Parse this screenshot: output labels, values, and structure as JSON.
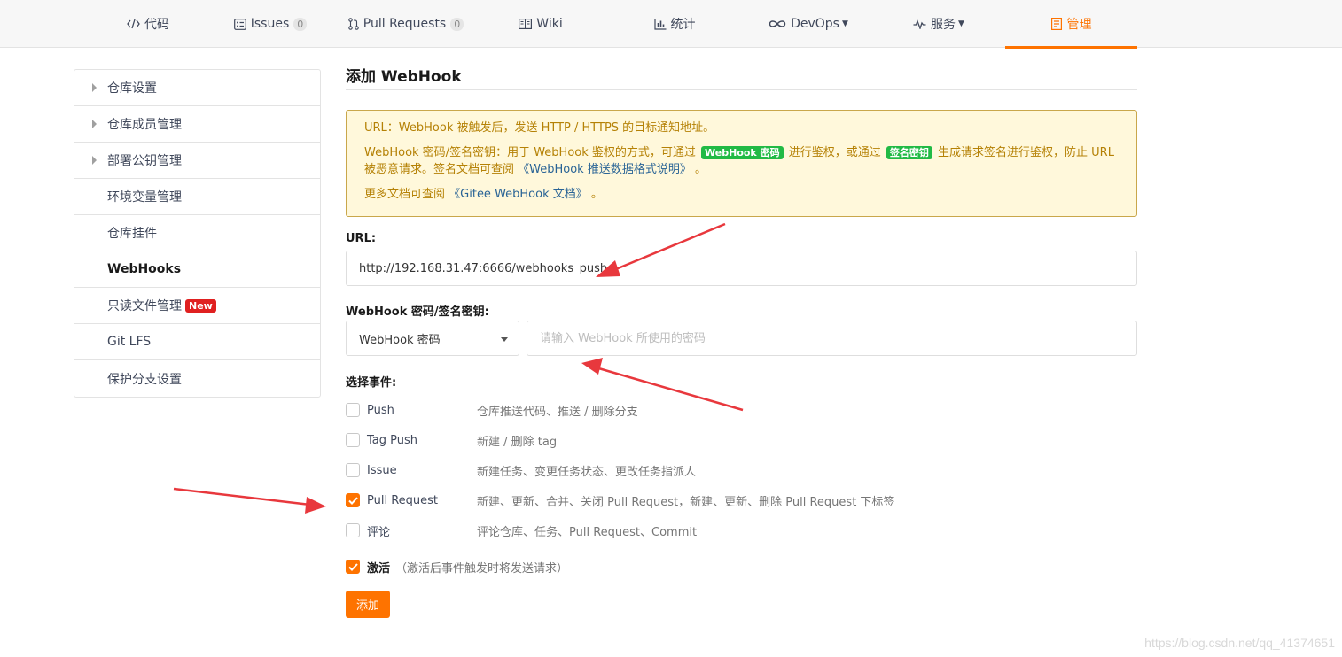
{
  "nav": {
    "tabs": [
      {
        "label": "代码",
        "icon": "code-icon"
      },
      {
        "label": "Issues",
        "count": "0",
        "icon": "issues-icon"
      },
      {
        "label": "Pull Requests",
        "count": "0",
        "icon": "pull-request-icon"
      },
      {
        "label": "Wiki",
        "icon": "wiki-icon"
      },
      {
        "label": "统计",
        "icon": "chart-icon"
      },
      {
        "label": "DevOps",
        "icon": "devops-icon",
        "caret": "▼"
      },
      {
        "label": "服务",
        "icon": "pulse-icon",
        "caret": "▼"
      },
      {
        "label": "管理",
        "icon": "manage-icon",
        "active": true
      }
    ]
  },
  "sidebar": {
    "items": [
      {
        "label": "仓库设置",
        "caret": true
      },
      {
        "label": "仓库成员管理",
        "caret": true
      },
      {
        "label": "部署公钥管理",
        "caret": true
      },
      {
        "label": "环境变量管理"
      },
      {
        "label": "仓库挂件"
      },
      {
        "label": "WebHooks",
        "active": true
      },
      {
        "label": "只读文件管理",
        "badge": "New"
      },
      {
        "label": "Git LFS"
      },
      {
        "label": "保护分支设置"
      }
    ]
  },
  "main": {
    "title": "添加 WebHook",
    "notice": {
      "line1": "URL：WebHook 被触发后，发送 HTTP / HTTPS 的目标通知地址。",
      "line2_a": "WebHook 密码/签名密钥：用于 WebHook 鉴权的方式，可通过",
      "line2_label1": "WebHook 密码",
      "line2_b": "进行鉴权，或通过",
      "line2_label2": "签名密钥",
      "line2_c": "生成请求签名进行鉴权，防止 URL 被恶意请求。签名文档可查阅",
      "line2_link": "《WebHook 推送数据格式说明》",
      "line2_d": "。",
      "line3_a": "更多文档可查阅",
      "line3_link": "《Gitee WebHook 文档》",
      "line3_b": "。"
    },
    "url_label": "URL:",
    "url_value": "http://192.168.31.47:6666/webhooks_push",
    "secret_label": "WebHook 密码/签名密钥:",
    "secret_type": "WebHook 密码",
    "secret_placeholder": "请输入 WebHook 所使用的密码",
    "events_label": "选择事件:",
    "events": [
      {
        "name": "Push",
        "desc": "仓库推送代码、推送 / 删除分支",
        "checked": false
      },
      {
        "name": "Tag Push",
        "desc": "新建 / 删除 tag",
        "checked": false
      },
      {
        "name": "Issue",
        "desc": "新建任务、变更任务状态、更改任务指派人",
        "checked": false
      },
      {
        "name": "Pull Request",
        "desc": "新建、更新、合并、关闭 Pull Request，新建、更新、删除 Pull Request 下标签",
        "checked": true
      },
      {
        "name": "评论",
        "desc": "评论仓库、任务、Pull Request、Commit",
        "checked": false
      }
    ],
    "activate_label": "激活",
    "activate_hint": "（激活后事件触发时将发送请求）",
    "activate_checked": true,
    "submit_label": "添加"
  },
  "watermark": "https://blog.csdn.net/qq_41374651",
  "colors": {
    "accent": "#fe7300",
    "notice_bg": "#fff8db",
    "notice_text": "#b58105",
    "label_green": "#21ba45",
    "badge_red": "#e02020",
    "annotation_arrow": "#e8383d"
  }
}
